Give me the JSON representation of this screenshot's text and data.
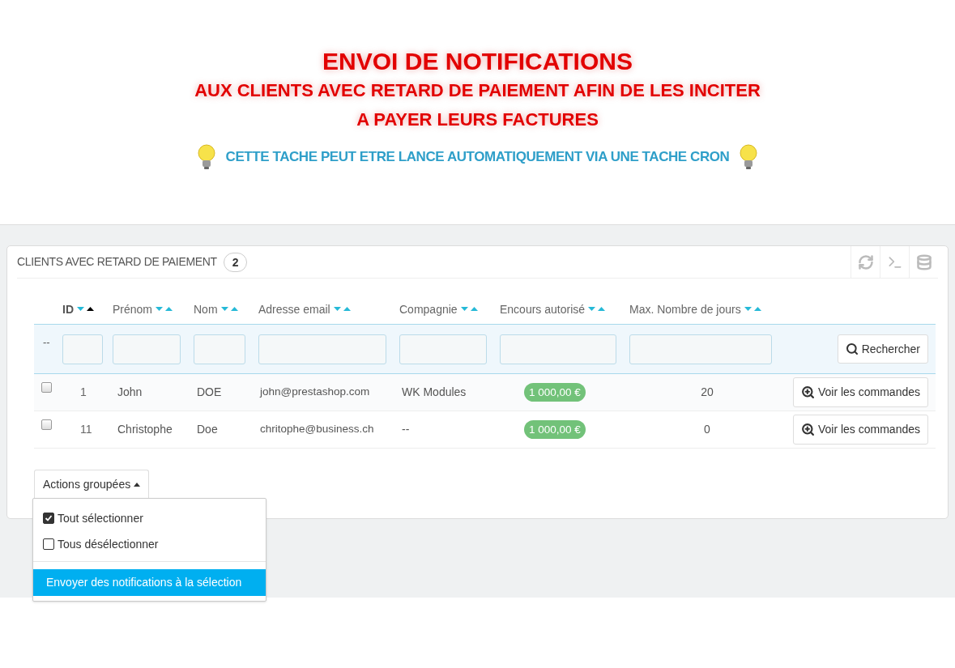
{
  "banner": {
    "title": "ENVOI DE NOTIFICATIONS",
    "subtitle_lines": [
      "AUX CLIENTS AVEC RETARD DE PAIEMENT AFIN DE LES INCITER",
      "A PAYER LEURS FACTURES"
    ],
    "note": "CETTE TACHE PEUT ETRE LANCE AUTOMATIQUEMENT VIA UNE TACHE CRON"
  },
  "panel": {
    "title": "CLIENTS AVEC RETARD DE PAIEMENT",
    "count": "2",
    "columns": [
      {
        "label": "ID",
        "sorted_asc": true
      },
      {
        "label": "Prénom",
        "sorted_asc": false
      },
      {
        "label": "Nom",
        "sorted_asc": false
      },
      {
        "label": "Adresse email",
        "sorted_asc": false
      },
      {
        "label": "Compagnie",
        "sorted_asc": false
      },
      {
        "label": "Encours autorisé",
        "sorted_asc": false
      },
      {
        "label": "Max. Nombre de jours",
        "sorted_asc": false
      }
    ],
    "filter_marker": "--",
    "search_button": "Rechercher",
    "rows": [
      {
        "checked": false,
        "id": "1",
        "first": "John",
        "last": "DOE",
        "email": "john@prestashop.com",
        "company": "WK Modules",
        "credit": "1 000,00 €",
        "days": "20",
        "action": "Voir les commandes"
      },
      {
        "checked": false,
        "id": "11",
        "first": "Christophe",
        "last": "Doe",
        "email": "chritophe@business.ch",
        "company": "--",
        "credit": "1 000,00 €",
        "days": "0",
        "action": "Voir les commandes"
      }
    ],
    "bulk": {
      "label": "Actions groupées",
      "expanded": true,
      "items": [
        {
          "kind": "checkbox",
          "label": "Tout sélectionner",
          "checked": true
        },
        {
          "kind": "checkbox",
          "label": "Tous désélectionner",
          "checked": false
        },
        {
          "kind": "divider"
        },
        {
          "kind": "action",
          "label": "Envoyer des notifications à la sélection",
          "selected": true
        }
      ]
    }
  }
}
